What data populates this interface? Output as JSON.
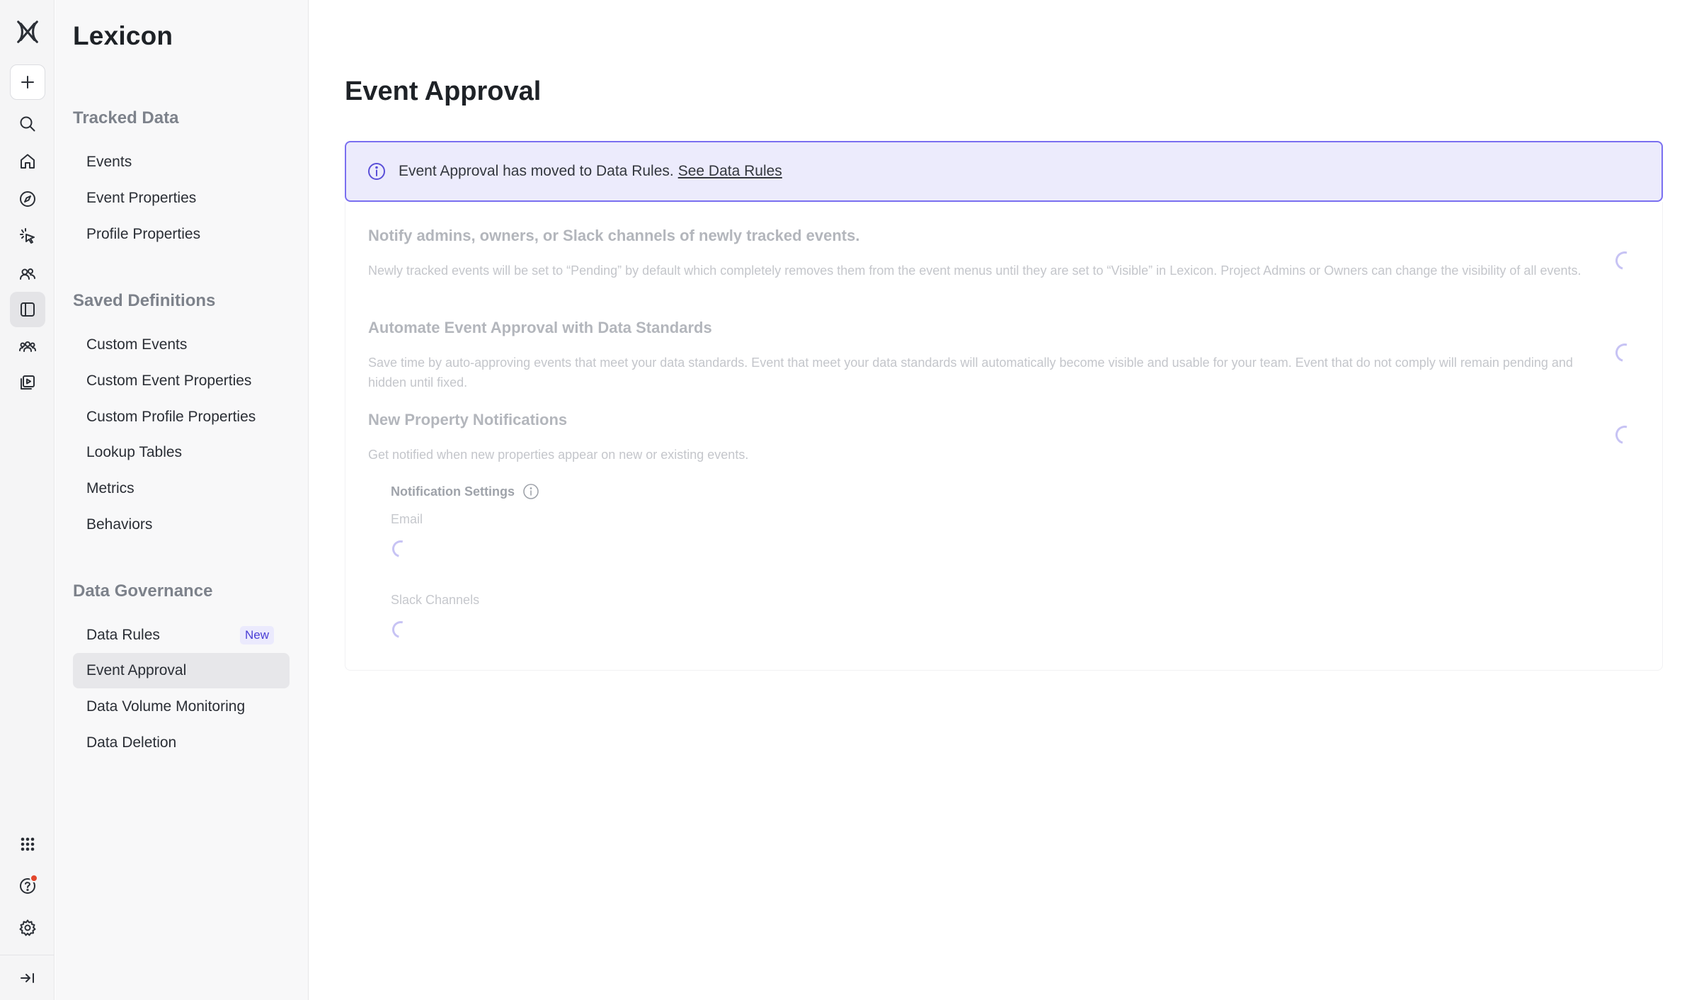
{
  "app": {
    "title": "Lexicon"
  },
  "rail": {
    "icons": [
      "mixpanel-logo-icon",
      "plus-icon",
      "search-icon",
      "home-icon",
      "compass-icon",
      "cursor-click-icon",
      "users-icon",
      "sidebar-panel-icon",
      "group-icon",
      "video-library-icon",
      "apps-grid-icon",
      "help-icon",
      "gear-icon",
      "collapse-arrow-icon"
    ]
  },
  "nav": {
    "sections": [
      {
        "label": "Tracked Data",
        "items": [
          "Events",
          "Event Properties",
          "Profile Properties"
        ]
      },
      {
        "label": "Saved Definitions",
        "items": [
          "Custom Events",
          "Custom Event Properties",
          "Custom Profile Properties",
          "Lookup Tables",
          "Metrics",
          "Behaviors"
        ]
      },
      {
        "label": "Data Governance",
        "items": [
          "Data Rules",
          "Event Approval",
          "Data Volume Monitoring",
          "Data Deletion"
        ]
      }
    ],
    "badge_new": "New",
    "selected": "Event Approval"
  },
  "main": {
    "title": "Event Approval",
    "banner": {
      "text": "Event Approval has moved to Data Rules.",
      "link": "See Data Rules"
    },
    "settings": [
      {
        "title": "Notify admins, owners, or Slack channels of newly tracked events.",
        "desc": "Newly tracked events will be set to “Pending” by default which completely removes them from the event menus until they are set to “Visible” in Lexicon. Project Admins or Owners can change the visibility of all events."
      },
      {
        "title": "Automate Event Approval with Data Standards",
        "desc": "Save time by auto-approving events that meet your data standards. Event that meet your data standards will automatically become visible and usable for your team. Event that do not comply will remain pending and hidden until fixed."
      },
      {
        "title": "New Property Notifications",
        "desc": "Get notified when new properties appear on new or existing events."
      }
    ],
    "notification_settings": {
      "label": "Notification Settings",
      "email_label": "Email",
      "slack_label": "Slack Channels"
    }
  },
  "colors": {
    "accent": "#7a6ff0",
    "banner_bg": "#ecebfc",
    "badge_text": "#4b3fd6",
    "notif_dot": "#e3462b"
  }
}
